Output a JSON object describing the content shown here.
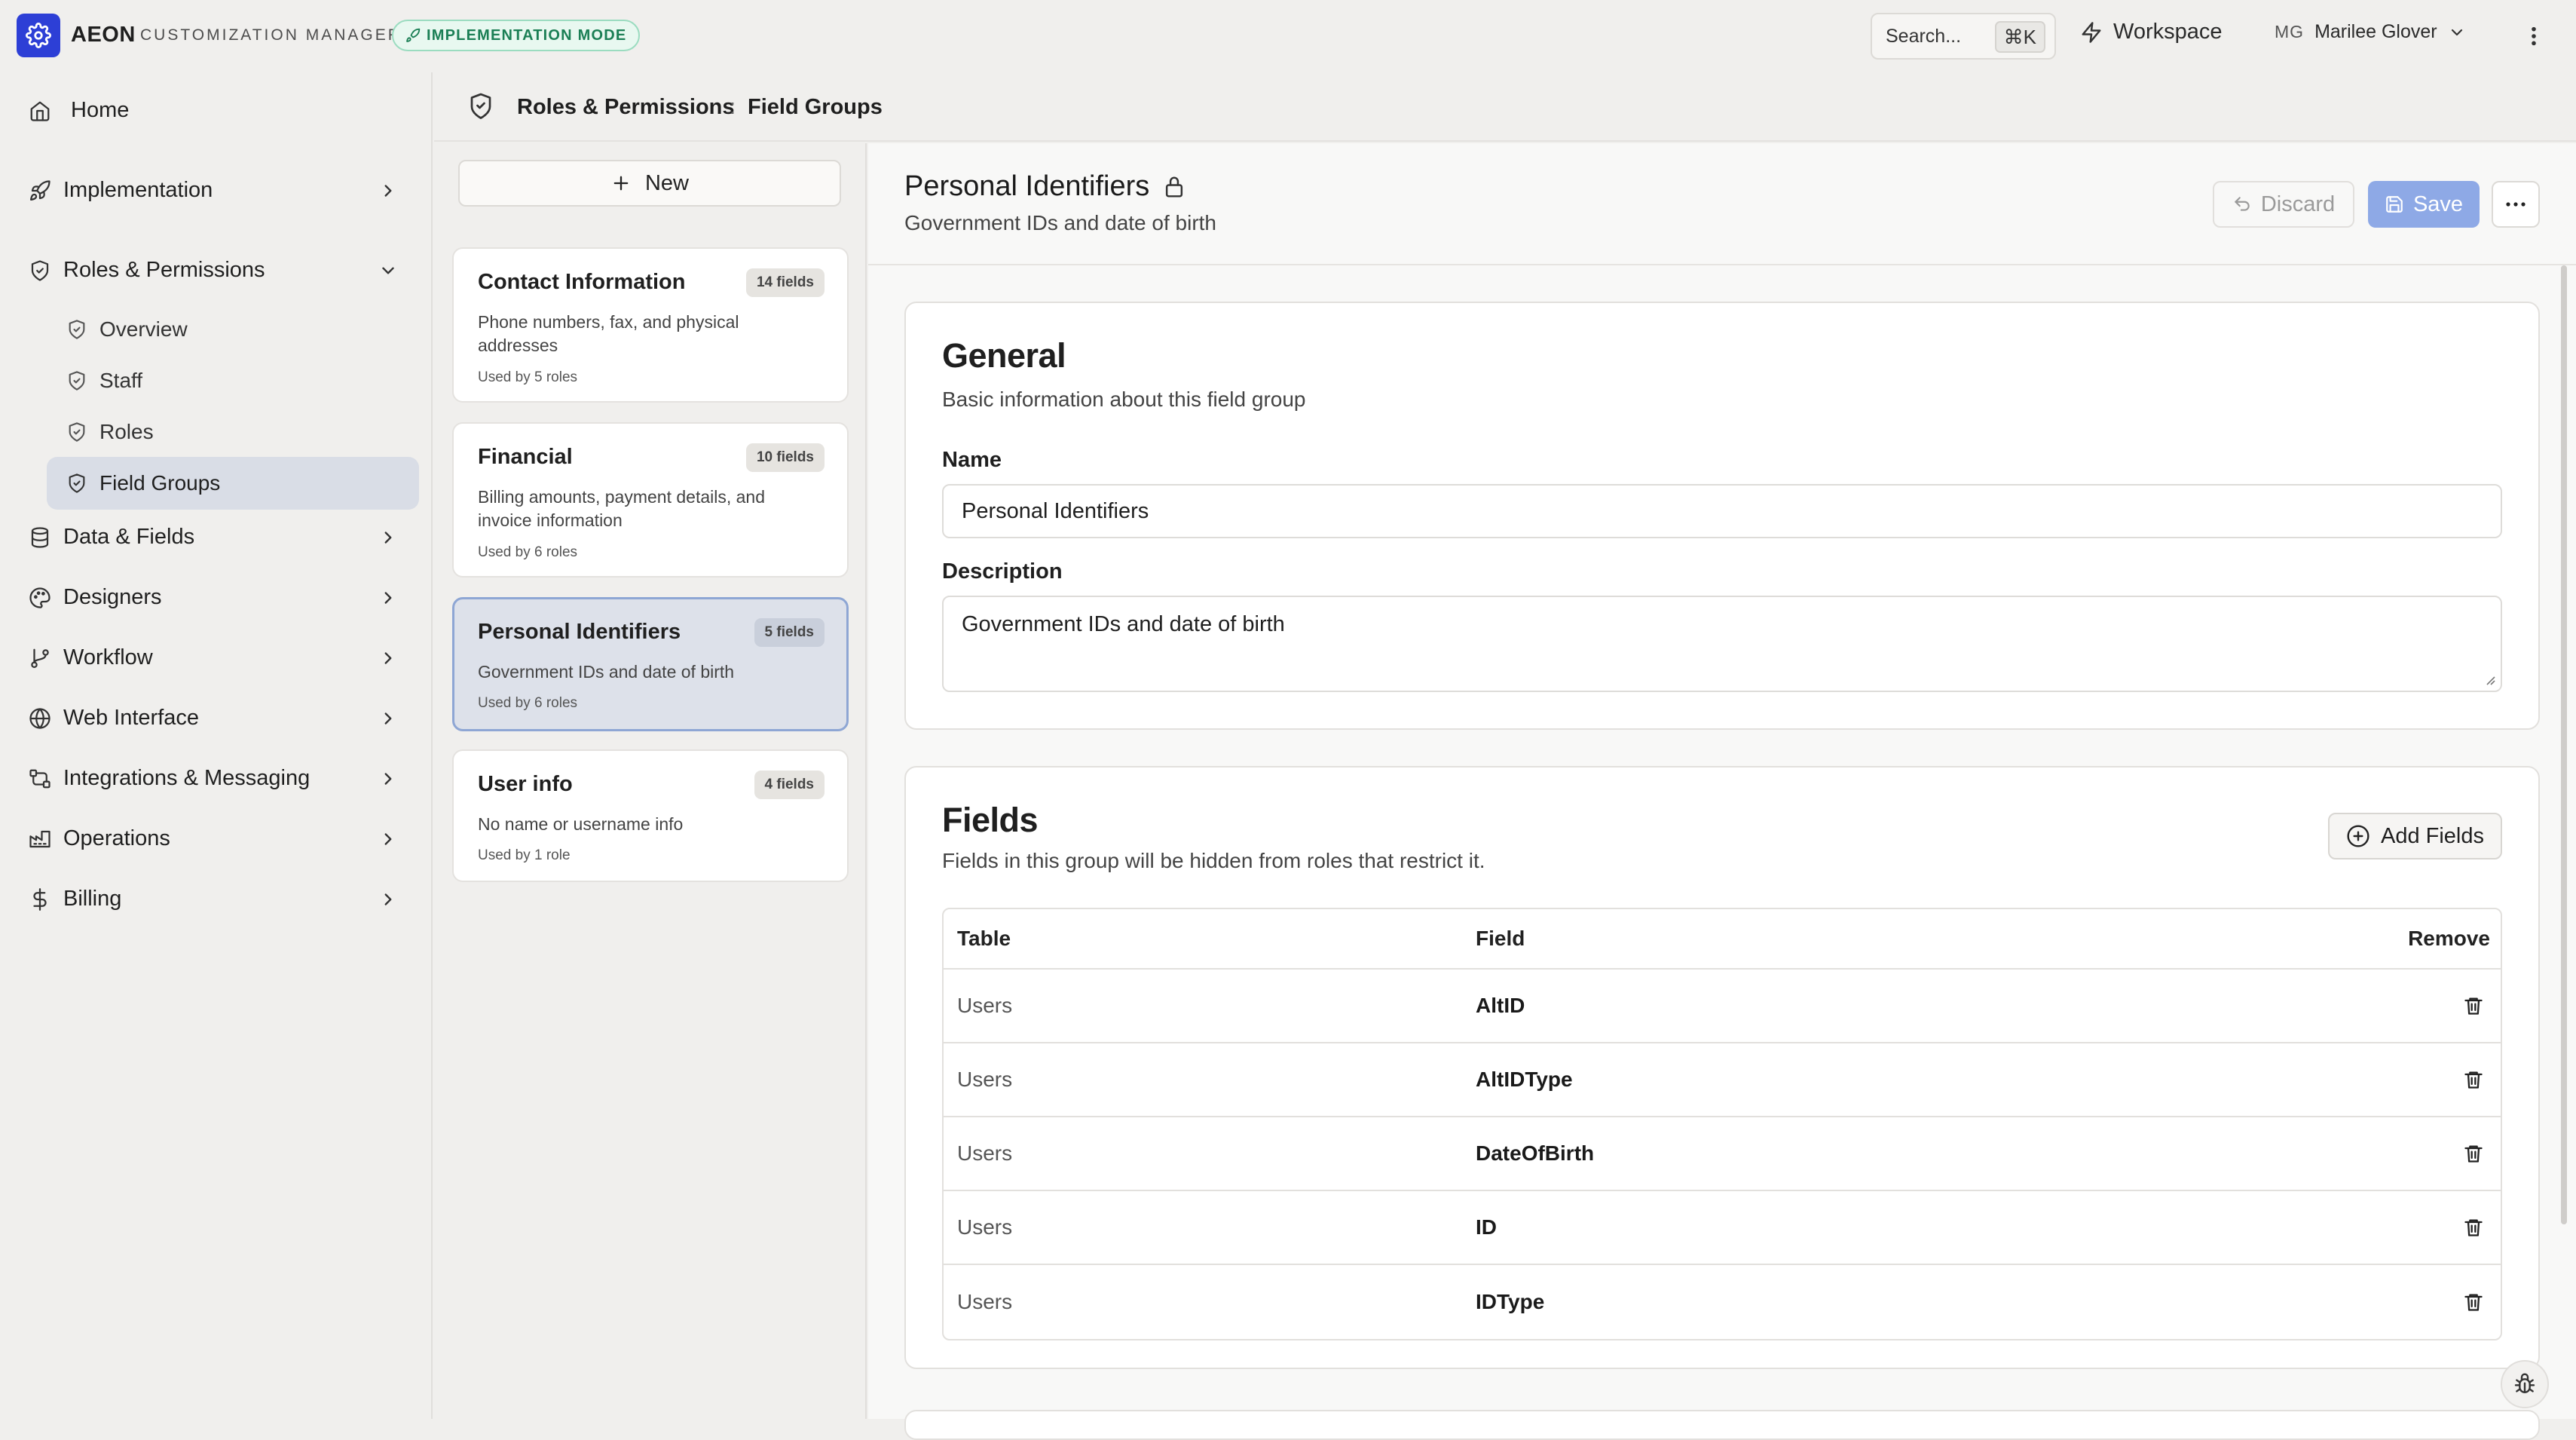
{
  "app": {
    "brand": "AEON",
    "subtitle": "CUSTOMIZATION MANAGER",
    "mode_badge": "IMPLEMENTATION MODE",
    "accent_color": "#2d3fd6"
  },
  "topbar": {
    "search_label": "Search...",
    "search_shortcut": "⌘K",
    "workspace_label": "Workspace",
    "user_initials": "MG",
    "user_name": "Marilee Glover"
  },
  "sidebar": {
    "home": "Home",
    "items": [
      {
        "label": "Implementation",
        "icon": "rocket-icon"
      },
      {
        "label": "Roles & Permissions",
        "icon": "shield-icon",
        "expanded": true
      },
      {
        "label": "Data & Fields",
        "icon": "database-icon"
      },
      {
        "label": "Designers",
        "icon": "palette-icon"
      },
      {
        "label": "Workflow",
        "icon": "git-branch-icon"
      },
      {
        "label": "Web Interface",
        "icon": "globe-icon"
      },
      {
        "label": "Integrations & Messaging",
        "icon": "integrations-icon"
      },
      {
        "label": "Operations",
        "icon": "factory-icon"
      },
      {
        "label": "Billing",
        "icon": "dollar-icon"
      }
    ],
    "sub_items": [
      "Overview",
      "Staff",
      "Roles",
      "Field Groups"
    ],
    "active_sub": "Field Groups"
  },
  "breadcrumb": {
    "parent": "Roles & Permissions",
    "separator": ":",
    "current": "Field Groups"
  },
  "list": {
    "new_label": "New",
    "cards": [
      {
        "title": "Contact Information",
        "badge": "14 fields",
        "description": "Phone numbers, fax, and physical addresses",
        "used": "Used by 5 roles"
      },
      {
        "title": "Financial",
        "badge": "10 fields",
        "description": "Billing amounts, payment details, and invoice information",
        "used": "Used by 6 roles"
      },
      {
        "title": "Personal Identifiers",
        "badge": "5 fields",
        "description": "Government IDs and date of birth",
        "used": "Used by 6 roles",
        "selected": true
      },
      {
        "title": "User info",
        "badge": "4 fields",
        "description": "No name or username info",
        "used": "Used by 1 role"
      }
    ]
  },
  "detail": {
    "title": "Personal Identifiers",
    "subtitle": "Government IDs and date of birth",
    "discard_label": "Discard",
    "save_label": "Save",
    "general": {
      "title": "General",
      "subtitle": "Basic information about this field group",
      "name_label": "Name",
      "name_value": "Personal Identifiers",
      "description_label": "Description",
      "description_value": "Government IDs and date of birth"
    },
    "fields": {
      "title": "Fields",
      "subtitle": "Fields in this group will be hidden from roles that restrict it.",
      "add_label": "Add Fields",
      "columns": [
        "Table",
        "Field",
        "Remove"
      ],
      "rows": [
        {
          "table": "Users",
          "field": "AltID"
        },
        {
          "table": "Users",
          "field": "AltIDType"
        },
        {
          "table": "Users",
          "field": "DateOfBirth"
        },
        {
          "table": "Users",
          "field": "ID"
        },
        {
          "table": "Users",
          "field": "IDType"
        }
      ]
    }
  }
}
